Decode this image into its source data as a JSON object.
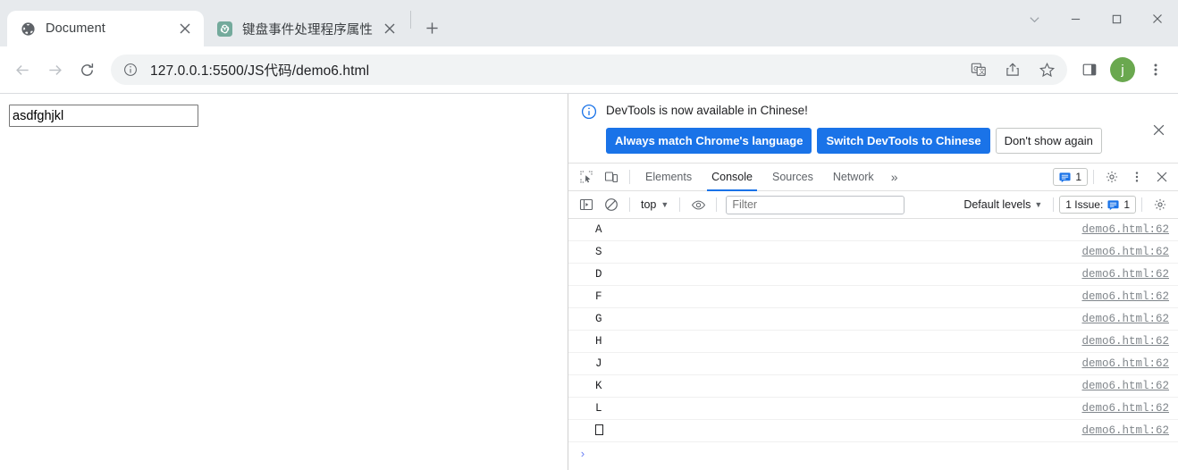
{
  "window": {
    "controls": [
      {
        "name": "tab-search",
        "glyph": "chevron-down"
      },
      {
        "name": "minimize",
        "glyph": "minimize"
      },
      {
        "name": "maximize",
        "glyph": "maximize"
      },
      {
        "name": "close",
        "glyph": "close"
      }
    ]
  },
  "tabs": [
    {
      "title": "Document",
      "favicon": "globe-icon",
      "active": true
    },
    {
      "title": "键盘事件处理程序属性",
      "favicon": "chatgpt-icon",
      "active": false
    }
  ],
  "newtab_label": "+",
  "toolbar": {
    "back_label": "←",
    "forward_label": "→",
    "reload_label": "⟳",
    "url": "127.0.0.1:5500/JS代码/demo6.html",
    "info_icon": "site-info-icon",
    "actions": [
      {
        "name": "translate-icon"
      },
      {
        "name": "share-icon"
      },
      {
        "name": "bookmark-star-icon"
      },
      {
        "name": "side-panel-icon"
      }
    ],
    "avatar_letter": "j",
    "avatar_color": "#6aa84f",
    "menu_label": "⋮"
  },
  "page": {
    "input_value": "asdfghjkl",
    "input_placeholder": ""
  },
  "devtools": {
    "banner": {
      "message": "DevTools is now available in Chinese!",
      "buttons": [
        {
          "label": "Always match Chrome's language",
          "style": "primary"
        },
        {
          "label": "Switch DevTools to Chinese",
          "style": "primary"
        },
        {
          "label": "Don't show again",
          "style": "secondary"
        }
      ],
      "close_label": "✕"
    },
    "tabs": [
      {
        "label": "Elements",
        "active": false
      },
      {
        "label": "Console",
        "active": true
      },
      {
        "label": "Sources",
        "active": false
      },
      {
        "label": "Network",
        "active": false
      }
    ],
    "more_tabs_label": "»",
    "left_tools": [
      {
        "name": "inspect-element-icon"
      },
      {
        "name": "device-toolbar-icon"
      }
    ],
    "issues_badge": {
      "count": "1"
    },
    "settings_label": "gear-icon",
    "kebab_label": "⋮",
    "close_label": "✕",
    "console_toolbar": {
      "sidebar_toggle": "console-sidebar-icon",
      "clear_label": "clear-console-icon",
      "context": "top",
      "eye_label": "live-expression-icon",
      "filter_placeholder": "Filter",
      "filter_value": "",
      "levels_label": "Default levels",
      "issues_label": "1 Issue:",
      "issues_count": "1",
      "settings_label": "console-settings-icon"
    },
    "messages": [
      {
        "text": "A",
        "source": "demo6.html:62"
      },
      {
        "text": "S",
        "source": "demo6.html:62"
      },
      {
        "text": "D",
        "source": "demo6.html:62"
      },
      {
        "text": "F",
        "source": "demo6.html:62"
      },
      {
        "text": "G",
        "source": "demo6.html:62"
      },
      {
        "text": "H",
        "source": "demo6.html:62"
      },
      {
        "text": "J",
        "source": "demo6.html:62"
      },
      {
        "text": "K",
        "source": "demo6.html:62"
      },
      {
        "text": "L",
        "source": "demo6.html:62"
      },
      {
        "text": "□",
        "source": "demo6.html:62"
      }
    ],
    "prompt_symbol": "›"
  }
}
